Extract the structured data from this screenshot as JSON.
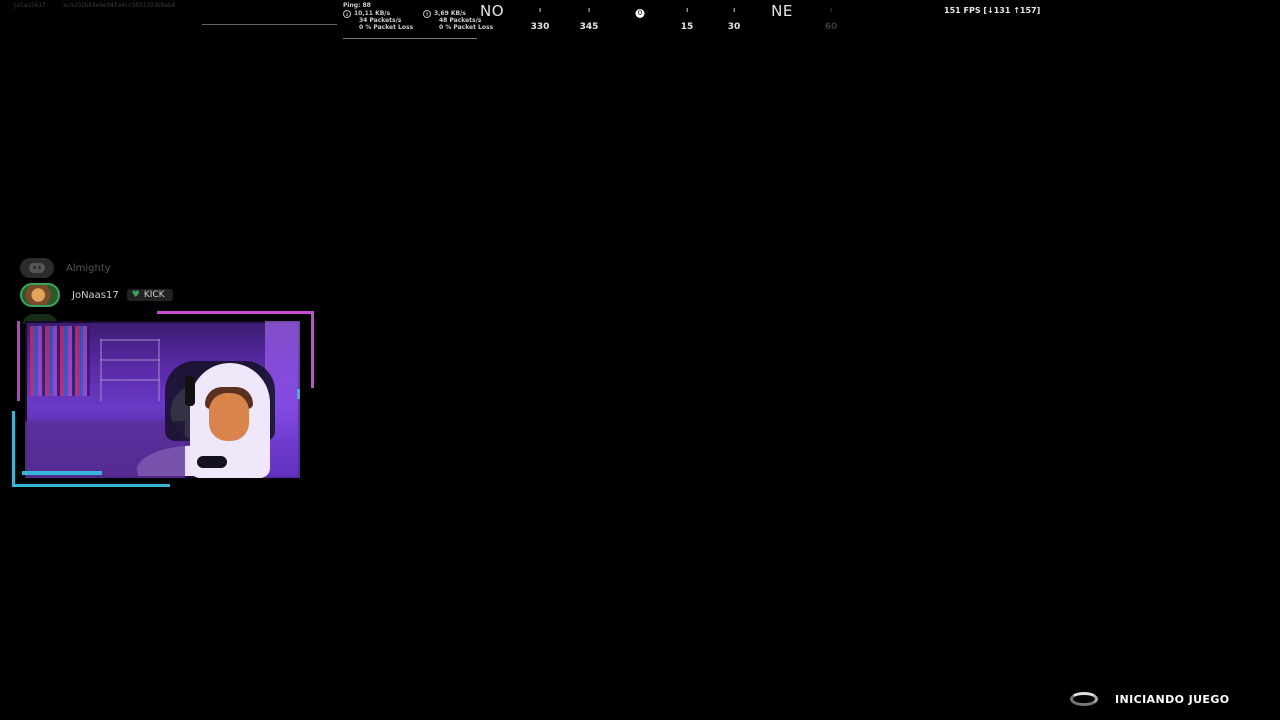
{
  "session": {
    "player_id": "jolas5617",
    "session_hash": "ecm292b63e6e94fa4cc3031393b0ab4"
  },
  "network": {
    "ping": "Ping: 88",
    "download": {
      "rate": "10,11 KB/s",
      "packets": "34 Packets/s",
      "loss": "0 % Packet Loss"
    },
    "upload": {
      "rate": "3,69 KB/s",
      "packets": "48 Packets/s",
      "loss": "0 % Packet Loss"
    }
  },
  "compass": {
    "marks": [
      {
        "label": "NO",
        "kind": "cardinal"
      },
      {
        "label": "330",
        "kind": "degree"
      },
      {
        "label": "345",
        "kind": "degree"
      },
      {
        "label": "0",
        "kind": "center"
      },
      {
        "label": "15",
        "kind": "degree"
      },
      {
        "label": "30",
        "kind": "degree"
      },
      {
        "label": "NE",
        "kind": "cardinal"
      },
      {
        "label": "60",
        "kind": "faded"
      }
    ]
  },
  "fps": "151 FPS [↓131 ↑157]",
  "voice": {
    "channel_icon": "discord-icon",
    "members": [
      {
        "name": "Almighty",
        "status": "idle"
      },
      {
        "name": "JoNaas17",
        "badge": "KICK",
        "badge_icon": "heart-icon",
        "status": "speaking"
      }
    ]
  },
  "loading": {
    "text": "INICIANDO JUEGO"
  }
}
